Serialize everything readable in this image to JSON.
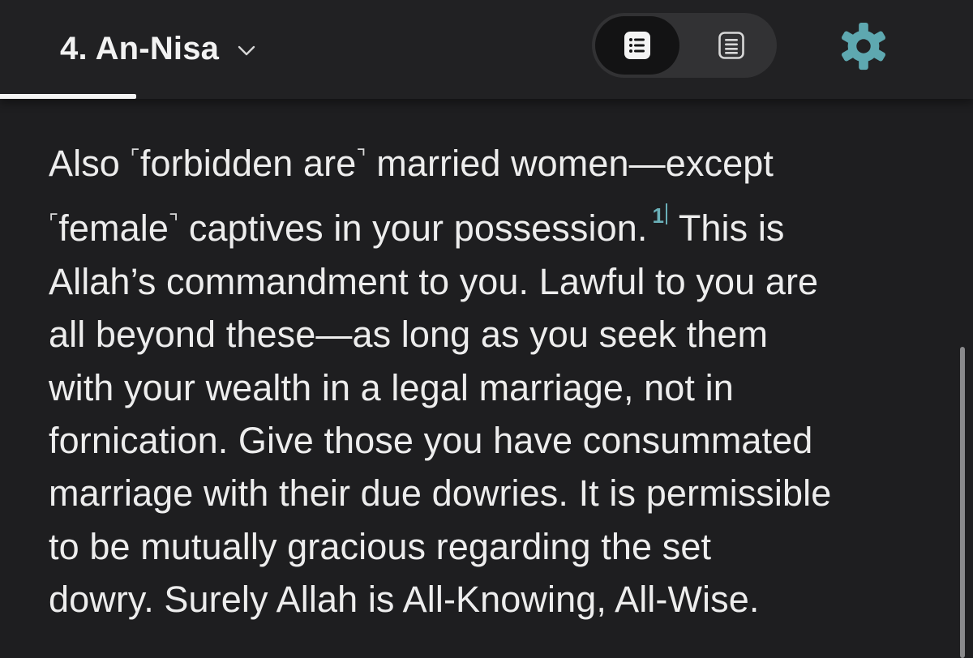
{
  "header": {
    "surah_title": "4. An-Nisa",
    "view_toggle": {
      "active": "verse-by-verse",
      "options": [
        "verse-by-verse-icon",
        "reading-page-icon"
      ]
    },
    "settings_icon": "gear-icon"
  },
  "colors": {
    "background": "#1e1e20",
    "text": "#ededed",
    "accent": "#5ea8b0"
  },
  "verse": {
    "lines": [
      [
        "Also ",
        "⌜",
        "forbidden are",
        "⌝",
        " married women—except"
      ],
      [
        "⌜",
        "female",
        "⌝",
        " captives in your possession."
      ],
      [
        "Allah’s commandment to you. Lawful to you are"
      ],
      [
        "all beyond these—as long as you seek them"
      ],
      [
        "with your wealth in a legal marriage, not in"
      ],
      [
        "fornication. Give those you have consummated"
      ],
      [
        "marriage with their due dowries. It is permissible"
      ],
      [
        "to be mutually gracious regarding the set"
      ],
      [
        "dowry. Surely Allah is All-Knowing, All-Wise."
      ]
    ],
    "line2_tail": " This is",
    "footnote_marker": "1"
  }
}
